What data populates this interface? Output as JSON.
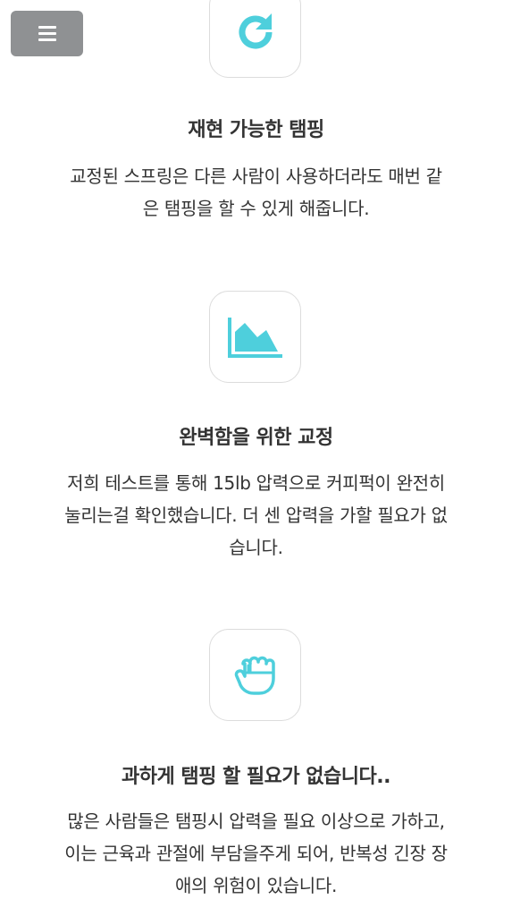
{
  "menu": {
    "icon": "hamburger-menu-icon"
  },
  "accent_color": "#4ecfdc",
  "features": [
    {
      "icon": "refresh-icon",
      "title": "재현 가능한 탬핑",
      "description": "교정된 스프링은 다른 사람이 사용하더라도 매번 같은 탬핑을 할 수 있게 해줍니다."
    },
    {
      "icon": "area-chart-icon",
      "title": "완벽함을 위한 교정",
      "description": "저희 테스트를 통해 15lb 압력으로 커피퍽이 완전히 눌리는걸 확인했습니다. 더 센 압력을 가할 필요가 없습니다."
    },
    {
      "icon": "fist-icon",
      "title": "과하게 탬핑 할 필요가 없습니다..",
      "description": "많은 사람들은 탬핑시 압력을 필요 이상으로 가하고, 이는 근육과 관절에 부담을주게 되어, 반복성 긴장 장애의 위험이 있습니다."
    }
  ]
}
